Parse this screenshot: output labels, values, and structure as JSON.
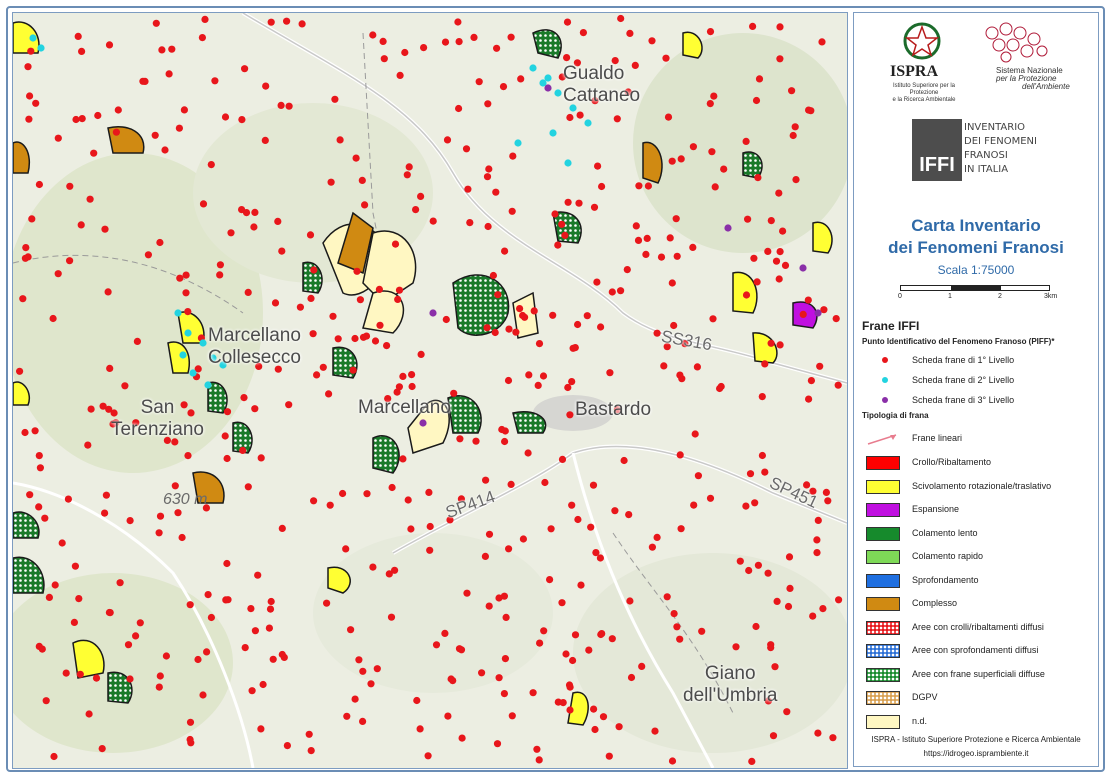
{
  "map": {
    "places": [
      {
        "name": "Gualdo\nCattaneo",
        "id": "gualdo-cattaneo"
      },
      {
        "name": "Marcellano\nCollesecco",
        "id": "marcellano-collesecco"
      },
      {
        "name": "San\nTerenziano",
        "id": "san-terenziano"
      },
      {
        "name": "Marcellano",
        "id": "marcellano"
      },
      {
        "name": "Bastardo",
        "id": "bastardo"
      },
      {
        "name": "Giano\ndell'Umbria",
        "id": "giano"
      }
    ],
    "roads": [
      "SS316",
      "SP414",
      "SP451"
    ],
    "elevation": "630 m"
  },
  "header": {
    "ispra": "ISPRA",
    "ispra_sub": "Istituto Superiore per la Protezione\ne la Ricerca Ambientale",
    "snpa_line1": "Sistema Nazionale",
    "snpa_line2": "per la Protezione",
    "snpa_line3": "dell'Ambiente",
    "iffi_logo": "IFFI",
    "iffi_lines": [
      "INVENTARIO",
      "DEI FENOMENI",
      "FRANOSI",
      "IN ITALIA"
    ]
  },
  "title": {
    "line1": "Carta Inventario",
    "line2": "dei Fenomeni Franosi",
    "scale": "Scala 1:75000"
  },
  "scalebar": {
    "ticks": [
      "0",
      "1",
      "2",
      "3km"
    ]
  },
  "legend": {
    "heading": "Frane IFFI",
    "piff_heading": "Punto Identificativo del Fenomeno Franoso (PIFF)*",
    "points": [
      {
        "label": "Scheda frane di 1° Livello",
        "color": "#e8161b"
      },
      {
        "label": "Scheda frane di 2° Livello",
        "color": "#22d3e0"
      },
      {
        "label": "Scheda frane di 3° Livello",
        "color": "#8a2fa8"
      }
    ],
    "tipologia_heading": "Tipologia di frana",
    "linear_label": "Frane lineari",
    "types": [
      {
        "label": "Crollo/Ribaltamento",
        "color": "#ff0000",
        "pattern": "solid"
      },
      {
        "label": "Scivolamento rotazionale/traslativo",
        "color": "#ffff33",
        "pattern": "solid"
      },
      {
        "label": "Espansione",
        "color": "#c010e0",
        "pattern": "solid"
      },
      {
        "label": "Colamento lento",
        "color": "#168a2c",
        "pattern": "solid"
      },
      {
        "label": "Colamento rapido",
        "color": "#7ed957",
        "pattern": "solid"
      },
      {
        "label": "Sprofondamento",
        "color": "#1f6fe0",
        "pattern": "solid"
      },
      {
        "label": "Complesso",
        "color": "#d08a12",
        "pattern": "solid"
      },
      {
        "label": "Aree con crolli/ribaltamenti diffusi",
        "color": "#e8161b",
        "pattern": "dots"
      },
      {
        "label": "Aree con sprofondamenti diffusi",
        "color": "#2a6fd6",
        "pattern": "dots"
      },
      {
        "label": "Aree con frane superficiali diffuse",
        "color": "#168a2c",
        "pattern": "dots"
      },
      {
        "label": "DGPV",
        "color": "#d9a050",
        "pattern": "dots"
      },
      {
        "label": "n.d.",
        "color": "#fff7c2",
        "pattern": "solid"
      }
    ]
  },
  "footer": {
    "line1": "ISPRA - Istituto Superiore Protezione e Ricerca Ambientale",
    "line2": "https://idrogeo.isprambiente.it"
  }
}
